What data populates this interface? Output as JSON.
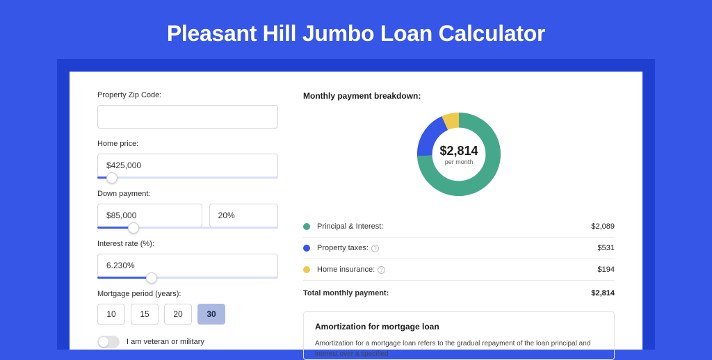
{
  "title": "Pleasant Hill Jumbo Loan Calculator",
  "form": {
    "zip_label": "Property Zip Code:",
    "zip_value": "",
    "home_price_label": "Home price:",
    "home_price_value": "$425,000",
    "home_price_slider_pct": 8,
    "down_payment_label": "Down payment:",
    "down_payment_value": "$85,000",
    "down_payment_pct_value": "20%",
    "down_payment_slider_pct": 20,
    "interest_label": "Interest rate (%):",
    "interest_value": "6.230%",
    "interest_slider_pct": 30,
    "term_label": "Mortgage period (years):",
    "terms": [
      "10",
      "15",
      "20",
      "30"
    ],
    "term_selected": "30",
    "veteran_label": "I am veteran or military"
  },
  "breakdown": {
    "title": "Monthly payment breakdown:",
    "center_amount": "$2,814",
    "center_sub": "per month",
    "items": [
      {
        "label": "Principal & Interest:",
        "value": "$2,089",
        "info": false,
        "color": "green",
        "num": 2089
      },
      {
        "label": "Property taxes:",
        "value": "$531",
        "info": true,
        "color": "blue",
        "num": 531
      },
      {
        "label": "Home insurance:",
        "value": "$194",
        "info": true,
        "color": "yellow",
        "num": 194
      }
    ],
    "total_label": "Total monthly payment:",
    "total_value": "$2,814"
  },
  "amortization": {
    "title": "Amortization for mortgage loan",
    "text": "Amortization for a mortgage loan refers to the gradual repayment of the loan principal and interest over a specified"
  },
  "chart_data": {
    "type": "pie",
    "title": "Monthly payment breakdown",
    "series": [
      {
        "name": "Principal & Interest",
        "value": 2089,
        "color": "#45a88a"
      },
      {
        "name": "Property taxes",
        "value": 531,
        "color": "#3556e6"
      },
      {
        "name": "Home insurance",
        "value": 194,
        "color": "#efc94c"
      }
    ],
    "total": 2814,
    "center_label": "$2,814 per month"
  }
}
